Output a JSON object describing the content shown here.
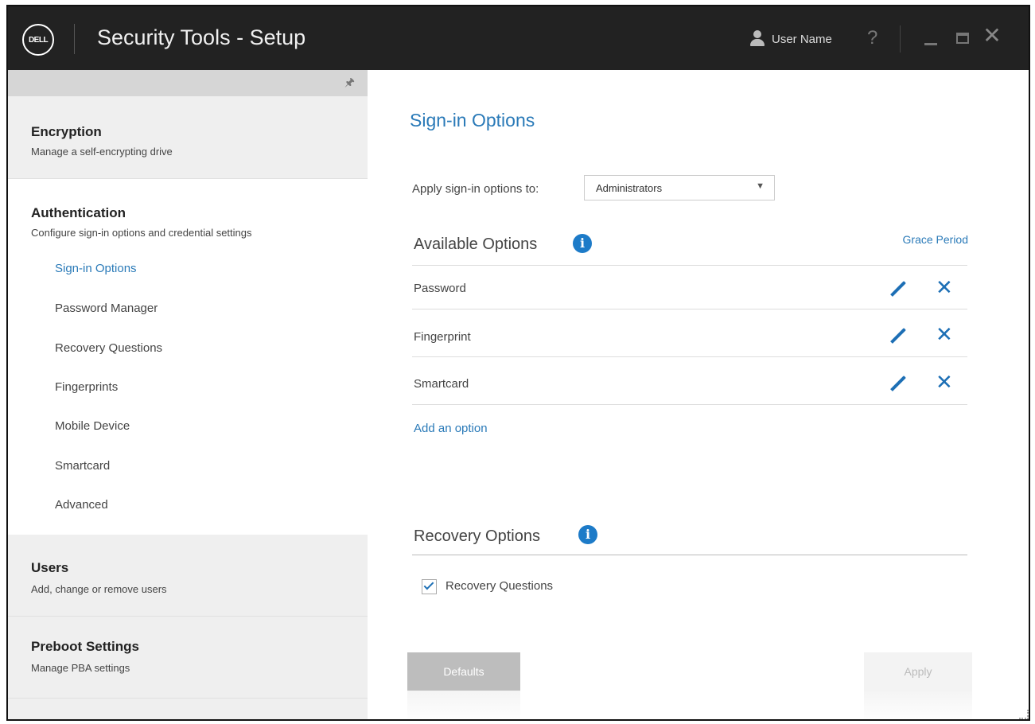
{
  "app": {
    "logo_text": "DELL",
    "title": "Security Tools - Setup",
    "user_name": "User Name",
    "help": "?",
    "close": "✕"
  },
  "sidebar": {
    "sections": [
      {
        "title": "Encryption",
        "subtitle": "Manage a self-encrypting drive"
      },
      {
        "title": "Authentication",
        "subtitle": "Configure sign-in options and credential settings"
      },
      {
        "title": "Users",
        "subtitle": "Add, change or remove users"
      },
      {
        "title": "Preboot Settings",
        "subtitle": "Manage PBA settings"
      }
    ],
    "auth_items": [
      "Sign-in Options",
      "Password Manager",
      "Recovery Questions",
      "Fingerprints",
      "Mobile Device",
      "Smartcard",
      "Advanced"
    ]
  },
  "main": {
    "title": "Sign-in Options",
    "apply_label": "Apply sign-in options to:",
    "apply_value": "Administrators",
    "available_title": "Available Options",
    "grace_period": "Grace Period",
    "options": [
      "Password",
      "Fingerprint",
      "Smartcard"
    ],
    "add_option": "Add an option",
    "recovery_title": "Recovery Options",
    "recovery_checkbox_label": "Recovery Questions",
    "recovery_checked": true,
    "defaults_button": "Defaults",
    "apply_button": "Apply"
  },
  "colors": {
    "accent": "#2a7ab8",
    "titlebar": "#222222",
    "sidebar_section": "#efefef"
  }
}
